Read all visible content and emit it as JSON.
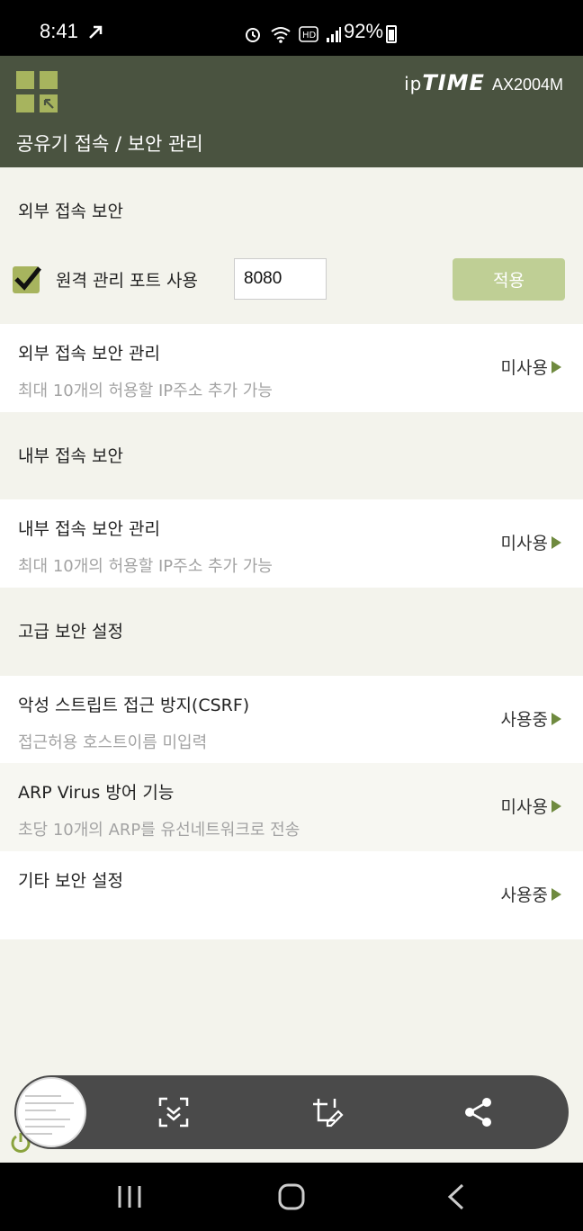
{
  "status_bar": {
    "time": "8:41",
    "battery": "92%"
  },
  "header": {
    "brand_ip": "ip",
    "brand_time": "TIME",
    "model": "AX2004M",
    "title": "공유기 접속 / 보안 관리"
  },
  "external": {
    "section_label": "외부 접속 보안",
    "remote_port_label": "원격 관리 포트 사용",
    "remote_port_checked": true,
    "port_value": "8080",
    "apply_label": "적용"
  },
  "rows": [
    {
      "main": "외부 접속 보안 관리",
      "sub": "최대 10개의 허용할 IP주소 추가 가능",
      "status": "미사용"
    },
    {
      "main": "내부 접속 보안 관리",
      "sub": "최대 10개의 허용할 IP주소 추가 가능",
      "status": "미사용"
    },
    {
      "main": "악성 스트립트 접근 방지(CSRF)",
      "sub": "접근허용 호스트이름 미입력",
      "status": "사용중"
    },
    {
      "main": "ARP Virus 방어 기능",
      "sub": "초당 10개의 ARP를 유선네트워크로 전송",
      "status": "미사용"
    },
    {
      "main": "기타 보안 설정",
      "sub": "",
      "status": "사용중"
    }
  ],
  "sections": {
    "internal": "내부 접속 보안",
    "advanced": "고급 보안 설정"
  },
  "colors": {
    "header_bg": "#4a5340",
    "accent": "#a7b45e",
    "arrow": "#6f8a3f",
    "apply_btn": "#bfcf95"
  }
}
